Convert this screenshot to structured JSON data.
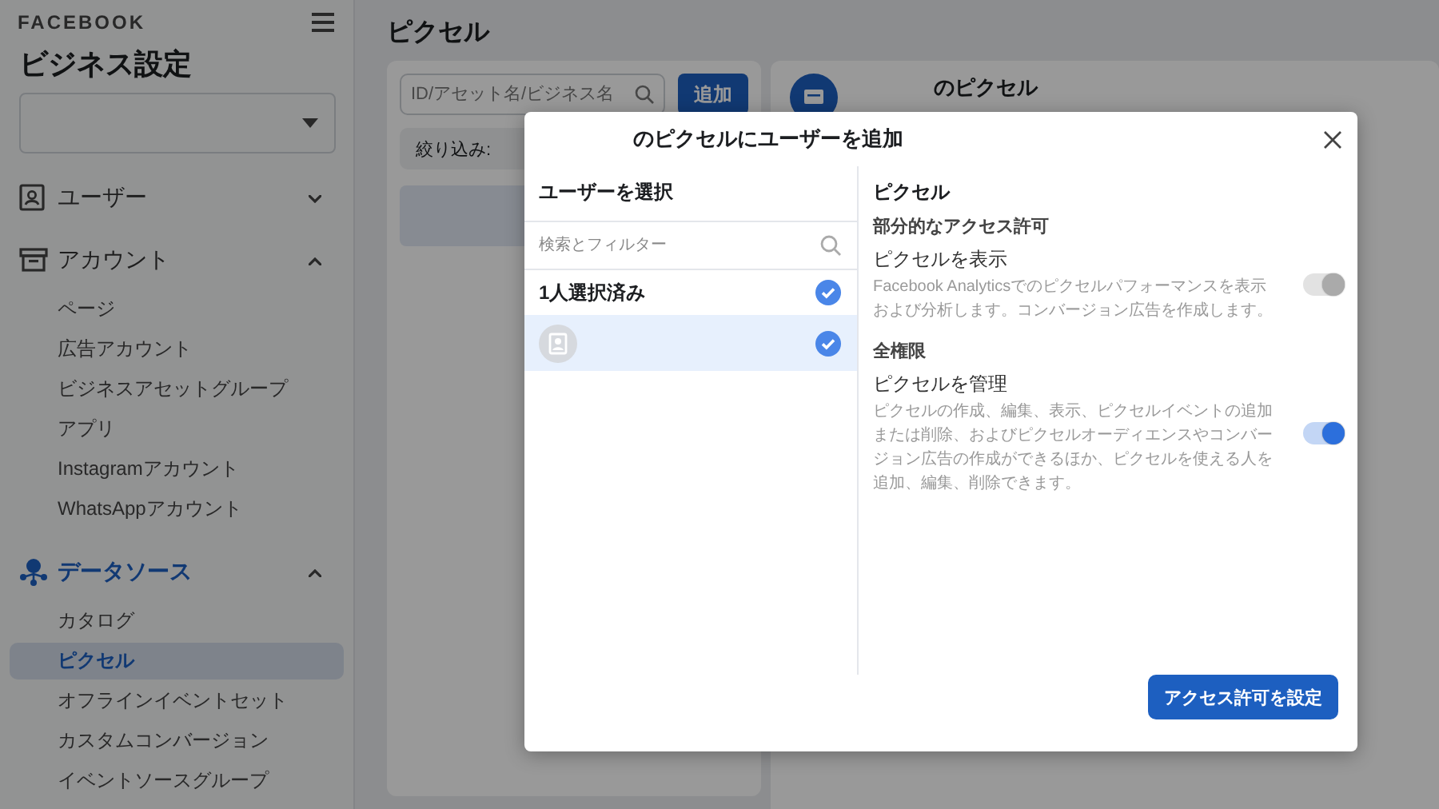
{
  "sidebar": {
    "brand": "FACEBOOK",
    "title": "ビジネス設定",
    "sections": [
      {
        "label": "ユーザー",
        "expanded": false,
        "active": false
      },
      {
        "label": "アカウント",
        "expanded": true,
        "active": false,
        "items": [
          {
            "label": "ページ",
            "selected": false
          },
          {
            "label": "広告アカウント",
            "selected": false
          },
          {
            "label": "ビジネスアセットグループ",
            "selected": false
          },
          {
            "label": "アプリ",
            "selected": false
          },
          {
            "label": "Instagramアカウント",
            "selected": false
          },
          {
            "label": "WhatsAppアカウント",
            "selected": false
          }
        ]
      },
      {
        "label": "データソース",
        "expanded": true,
        "active": true,
        "items": [
          {
            "label": "カタログ",
            "selected": false
          },
          {
            "label": "ピクセル",
            "selected": true
          },
          {
            "label": "オフラインイベントセット",
            "selected": false
          },
          {
            "label": "カスタムコンバージョン",
            "selected": false
          },
          {
            "label": "イベントソースグループ",
            "selected": false
          }
        ]
      }
    ]
  },
  "page": {
    "title": "ピクセル",
    "search": {
      "placeholder": "ID/アセット名/ビジネス名"
    },
    "add_button": "追加",
    "filter_label": "絞り込み:",
    "detail_title": "のピクセル"
  },
  "dialog": {
    "title": "のピクセルにユーザーを追加",
    "users_panel": {
      "heading": "ユーザーを選択",
      "search": {
        "placeholder": "検索とフィルター"
      },
      "summary": {
        "label": "1人選択済み",
        "checked": true
      },
      "users": [
        {
          "checked": true,
          "selected": true
        }
      ]
    },
    "permissions": {
      "heading": "ピクセル",
      "groups": [
        {
          "heading": "部分的なアクセス許可",
          "items": [
            {
              "title": "ピクセルを表示",
              "description": "Facebook Analyticsでのピクセルパフォーマンスを表示および分析します。コンバージョン広告を作成します。",
              "on": true,
              "disabled": true
            }
          ]
        },
        {
          "heading": "全権限",
          "items": [
            {
              "title": "ピクセルを管理",
              "description": "ピクセルの作成、編集、表示、ピクセルイベントの追加または削除、およびピクセルオーディエンスやコンバージョン広告の作成ができるほか、ピクセルを使える人を追加、編集、削除できます。",
              "on": true,
              "disabled": false
            }
          ]
        }
      ]
    },
    "submit_button": "アクセス許可を設定"
  }
}
